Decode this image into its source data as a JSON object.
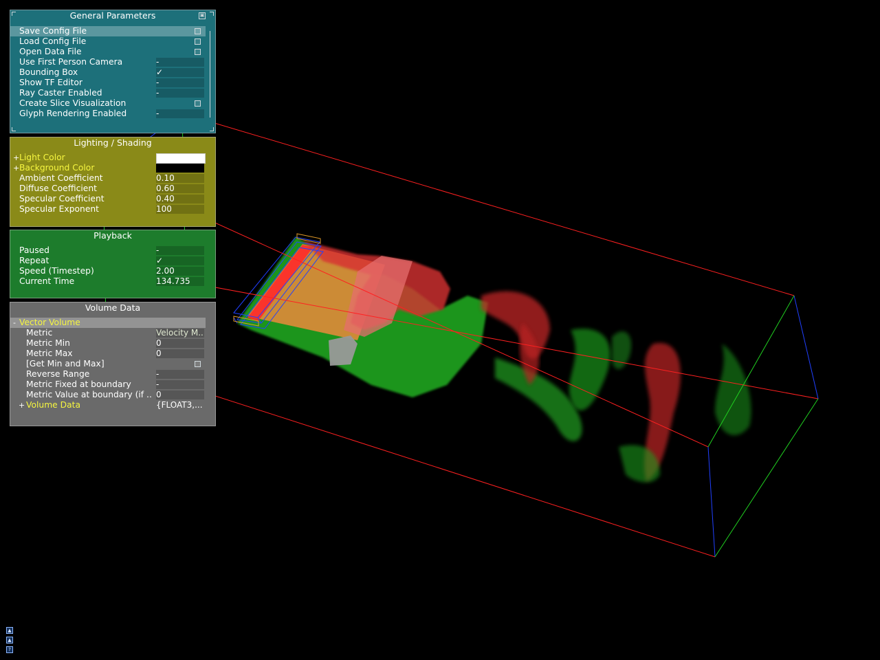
{
  "general": {
    "title": "General Parameters",
    "items": [
      {
        "label": "Save Config File",
        "value": "",
        "control": "checkbox"
      },
      {
        "label": "Load Config File",
        "value": "",
        "control": "checkbox"
      },
      {
        "label": "Open Data File",
        "value": "",
        "control": "checkbox"
      },
      {
        "label": "Use First Person Camera",
        "value": "-",
        "control": "toggle"
      },
      {
        "label": "Bounding Box",
        "value": "✓",
        "control": "toggle"
      },
      {
        "label": "Show TF Editor",
        "value": "-",
        "control": "toggle"
      },
      {
        "label": "Ray Caster Enabled",
        "value": "-",
        "control": "toggle"
      },
      {
        "label": "Create Slice Visualization",
        "value": "",
        "control": "checkbox"
      },
      {
        "label": "Glyph Rendering Enabled",
        "value": "-",
        "control": "toggle"
      }
    ]
  },
  "lighting": {
    "title": "Lighting / Shading",
    "light_color": {
      "label": "Light Color",
      "swatch": "#ffffff"
    },
    "background_color": {
      "label": "Background Color",
      "swatch": "#000000"
    },
    "items": [
      {
        "label": "Ambient Coefficient",
        "value": "0.10"
      },
      {
        "label": "Diffuse Coefficient",
        "value": "0.60"
      },
      {
        "label": "Specular Coefficient",
        "value": "0.40"
      },
      {
        "label": "Specular Exponent",
        "value": "100"
      }
    ]
  },
  "playback": {
    "title": "Playback",
    "items": [
      {
        "label": "Paused",
        "value": "-"
      },
      {
        "label": "Repeat",
        "value": "✓"
      },
      {
        "label": "Speed (Timestep)",
        "value": "2.00"
      },
      {
        "label": "Current Time",
        "value": "134.735"
      }
    ]
  },
  "volume": {
    "title": "Volume Data",
    "group_label": "Vector Volume",
    "items": [
      {
        "label": "Metric",
        "value": "Velocity M.."
      },
      {
        "label": "Metric Min",
        "value": "0"
      },
      {
        "label": "Metric Max",
        "value": "0"
      },
      {
        "label": "[Get Min and Max]",
        "value": ""
      },
      {
        "label": "Reverse Range",
        "value": "-"
      },
      {
        "label": "Metric Fixed at boundary",
        "value": "-"
      },
      {
        "label": "Metric Value at boundary (if ..",
        "value": "0"
      }
    ],
    "sub_group_label": "Volume Data",
    "sub_group_value": "{FLOAT3,..."
  },
  "colors": {
    "bounding_box": "#ff2020",
    "volume_red": "#d42020",
    "volume_green": "#20c020",
    "general_bg": "#1d707a",
    "lighting_bg": "#8a8a18",
    "playback_bg": "#1d7c2c",
    "volume_bg": "#6a6a6a",
    "group_label": "#f6f640"
  }
}
